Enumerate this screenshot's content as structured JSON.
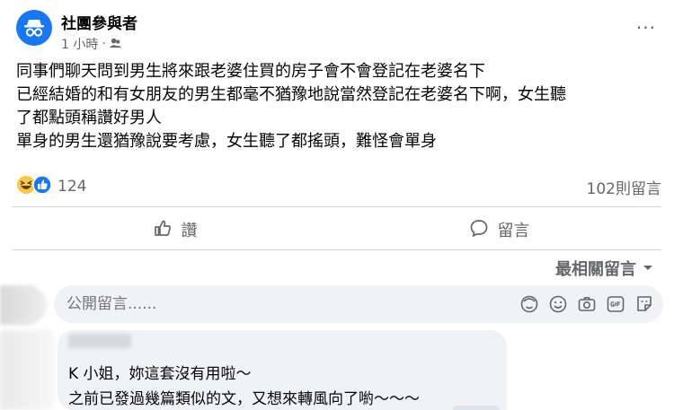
{
  "post": {
    "author": "社團參與者",
    "time": "1 小時",
    "dot": "·",
    "more": "···",
    "lines": [
      "同事們聊天問到男生將來跟老婆住買的房子會不會登記在老婆名下",
      "已經結婚的和有女朋友的男生都毫不猶豫地說當然登記在老婆名下啊，女生聽",
      "了都點頭稱讚好男人",
      "單身的男生還猶豫說要考慮，女生聽了都搖頭，難怪會單身"
    ],
    "reaction_count": "124",
    "comment_count": "102則留言"
  },
  "actions": {
    "like_label": "讚",
    "comment_label": "留言"
  },
  "sort": {
    "label": "最相關留言"
  },
  "comment_input": {
    "placeholder": "公開留言......"
  },
  "reply": {
    "line1": "K 小姐，妳這套沒有用啦～",
    "line2": "之前已發過幾篇類似的文，又想來轉風向了喲～～～"
  },
  "colors": {
    "brand": "#1877f2",
    "secondary_text": "#65676b",
    "bubble": "#f0f2f5"
  }
}
